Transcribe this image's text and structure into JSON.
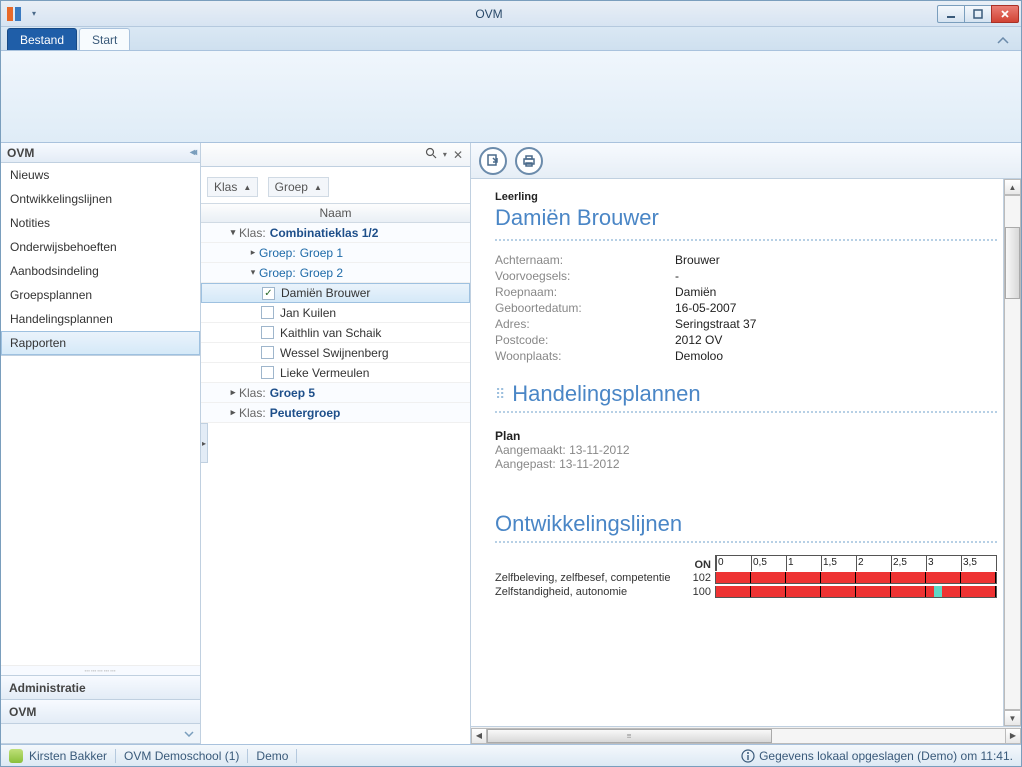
{
  "window": {
    "title": "OVM"
  },
  "ribbon": {
    "tabs": {
      "file": "Bestand",
      "start": "Start"
    }
  },
  "leftnav": {
    "header": "OVM",
    "items": [
      {
        "label": "Nieuws"
      },
      {
        "label": "Ontwikkelingslijnen"
      },
      {
        "label": "Notities"
      },
      {
        "label": "Onderwijsbehoeften"
      },
      {
        "label": "Aanbodsindeling"
      },
      {
        "label": "Groepsplannen"
      },
      {
        "label": "Handelingsplannen"
      },
      {
        "label": "Rapporten"
      }
    ],
    "section_admin": "Administratie",
    "section_ovm": "OVM"
  },
  "middle": {
    "groupers": {
      "klas": "Klas",
      "groep": "Groep"
    },
    "column": "Naam",
    "tree": {
      "klas_prefix": "Klas:",
      "groep_prefix": "Groep:",
      "klas1": "Combinatieklas 1/2",
      "groep1": "Groep 1",
      "groep2": "Groep 2",
      "pupils": [
        {
          "name": "Damiën Brouwer",
          "checked": true,
          "selected": true
        },
        {
          "name": "Jan Kuilen"
        },
        {
          "name": "Kaithlin van Schaik"
        },
        {
          "name": "Wessel Swijnenberg"
        },
        {
          "name": "Lieke Vermeulen"
        }
      ],
      "klas2": "Groep 5",
      "klas3": "Peutergroep"
    }
  },
  "detail": {
    "leerling_label": "Leerling",
    "student_name": "Damiën Brouwer",
    "fields": {
      "achternaam": {
        "k": "Achternaam:",
        "v": "Brouwer"
      },
      "voorvoegsels": {
        "k": "Voorvoegsels:",
        "v": "-"
      },
      "roepnaam": {
        "k": "Roepnaam:",
        "v": "Damiën"
      },
      "geboortedatum": {
        "k": "Geboortedatum:",
        "v": "16-05-2007"
      },
      "adres": {
        "k": "Adres:",
        "v": "Seringstraat 37"
      },
      "postcode": {
        "k": "Postcode:",
        "v": "2012 OV"
      },
      "woonplaats": {
        "k": "Woonplaats:",
        "v": "Demoloo"
      }
    },
    "section_hp": "Handelingsplannen",
    "plan": {
      "title": "Plan",
      "created_label": "Aangemaakt:",
      "created": "13-11-2012",
      "modified_label": "Aangepast:",
      "modified": "13-11-2012"
    },
    "section_ont": "Ontwikkelingslijnen",
    "dev": {
      "on_label": "ON",
      "ticks": [
        "0",
        "0,5",
        "1",
        "1,5",
        "2",
        "2,5",
        "3",
        "3,5"
      ],
      "rows": [
        {
          "name": "Zelfbeleving, zelfbesef, competentie",
          "val": "102"
        },
        {
          "name": "Zelfstandigheid, autonomie",
          "val": "100"
        }
      ]
    }
  },
  "status": {
    "user": "Kirsten Bakker",
    "school": "OVM Demoschool (1)",
    "mode": "Demo",
    "saved": "Gegevens lokaal opgeslagen (Demo) om 11:41."
  }
}
